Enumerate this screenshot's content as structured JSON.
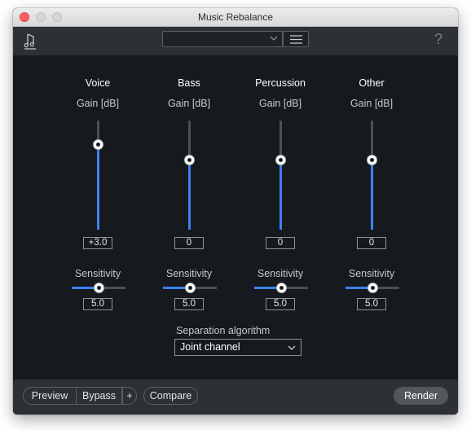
{
  "window": {
    "title": "Music Rebalance"
  },
  "toolbar": {
    "preset_value": "",
    "help_label": "?"
  },
  "columns": [
    {
      "name": "Voice",
      "gain_label": "Gain [dB]",
      "gain_value": "+3.0",
      "sensitivity_label": "Sensitivity",
      "sensitivity_value": "5.0"
    },
    {
      "name": "Bass",
      "gain_label": "Gain [dB]",
      "gain_value": "0",
      "sensitivity_label": "Sensitivity",
      "sensitivity_value": "5.0"
    },
    {
      "name": "Percussion",
      "gain_label": "Gain [dB]",
      "gain_value": "0",
      "sensitivity_label": "Sensitivity",
      "sensitivity_value": "5.0"
    },
    {
      "name": "Other",
      "gain_label": "Gain [dB]",
      "gain_value": "0",
      "sensitivity_label": "Sensitivity",
      "sensitivity_value": "5.0"
    }
  ],
  "separation": {
    "label": "Separation algorithm",
    "value": "Joint channel"
  },
  "footer": {
    "preview": "Preview",
    "bypass": "Bypass",
    "plus": "+",
    "compare": "Compare",
    "render": "Render"
  },
  "colors": {
    "accent": "#3b82ef",
    "panel": "#16191d",
    "toolbar": "#2d3035"
  }
}
